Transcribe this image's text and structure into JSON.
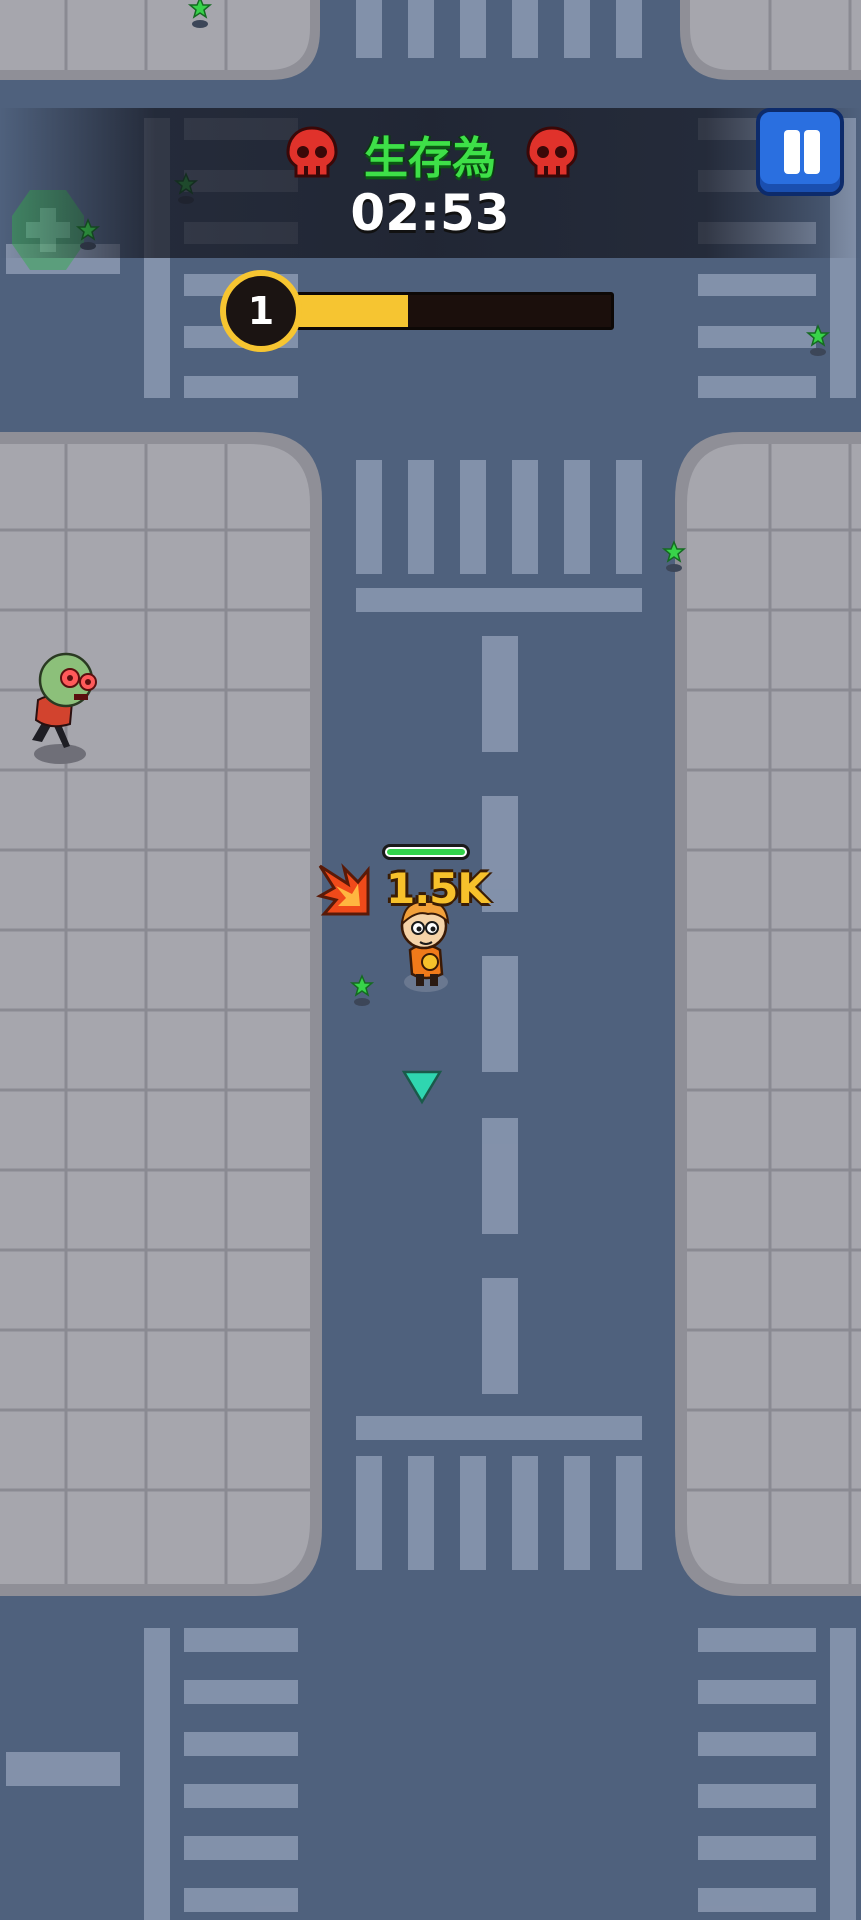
{
  "hud": {
    "title": "生存為",
    "timer": "02:53",
    "level": "1",
    "xp_progress": 0.35
  },
  "player": {
    "damage_text": "1.5K",
    "health": 1.0
  },
  "icons": [
    "skull-icon",
    "pause-icon",
    "star-gem-icon",
    "fire-burst-icon",
    "direction-arrow-icon",
    "heal-plus-icon"
  ],
  "colors": {
    "road": "#4f617d",
    "sidewalk": "#a6a6ad",
    "title_green": "#3ee048",
    "xp_gold": "#f6c531",
    "pause_blue": "#2a6fe0",
    "skull_red": "#e0322b",
    "health_green": "#33d34a",
    "arrow_teal": "#2fd6b0"
  }
}
